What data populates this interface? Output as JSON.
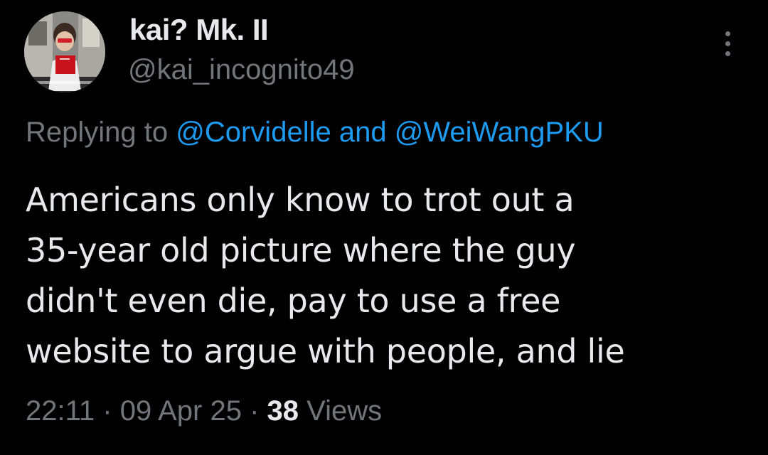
{
  "author": {
    "display_name": "kai? Mk. II",
    "handle": "@kai_incognito49"
  },
  "reply": {
    "prefix": "Replying to",
    "mention_1": "@Corvidelle",
    "conjunction": "and",
    "mention_2": "@WeiWangPKU"
  },
  "tweet": {
    "lines": [
      "Americans only know to trot out a",
      "35-year old picture where the guy",
      "didn't even die, pay to use a free",
      "website to argue with people, and lie"
    ]
  },
  "meta": {
    "time": "22:11",
    "separator": "·",
    "date": "09 Apr 25",
    "views_count": "38",
    "views_label": "Views"
  },
  "icons": {
    "more": "more-options-icon"
  },
  "colors": {
    "background": "#000000",
    "text_primary": "#e7e9ea",
    "text_secondary": "#71767b",
    "link": "#1d9bf0"
  }
}
